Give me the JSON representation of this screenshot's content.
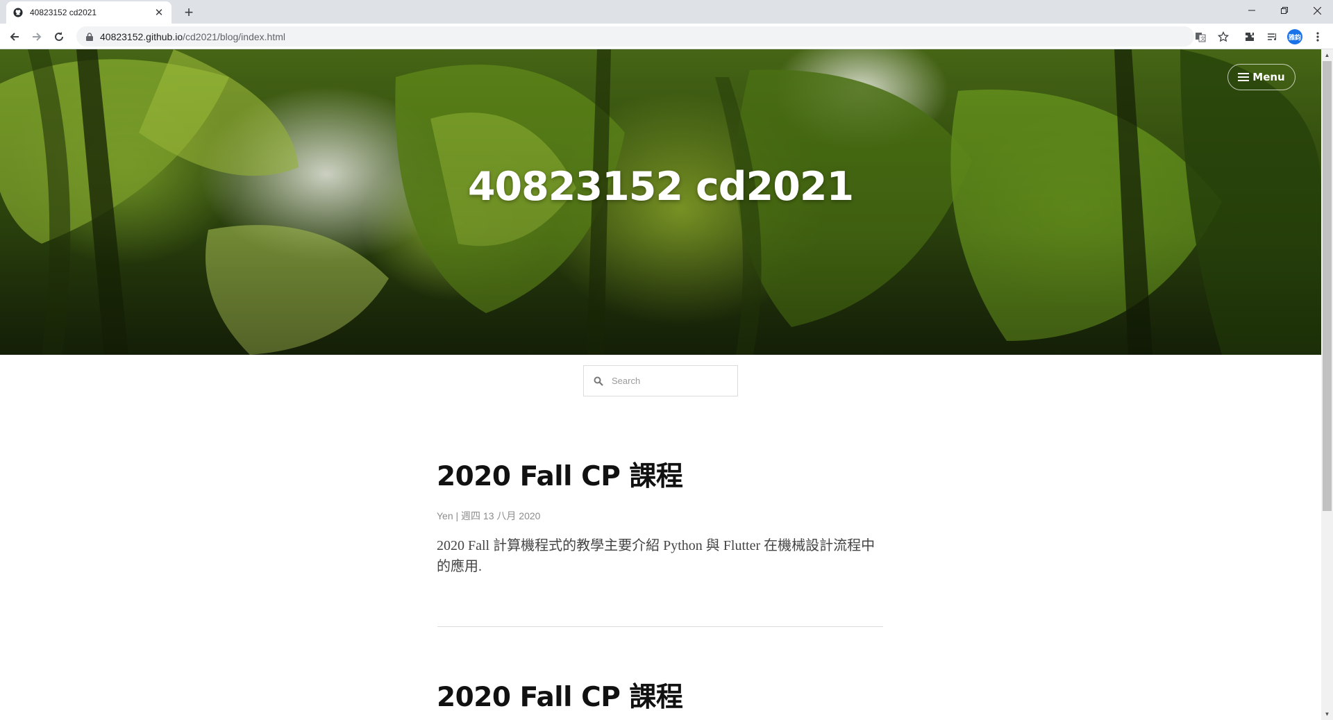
{
  "browser": {
    "tab_title": "40823152 cd2021",
    "url_host": "40823152.github.io",
    "url_path": "/cd2021/blog/index.html",
    "profile_initials": "雅鈞"
  },
  "hero": {
    "title": "40823152 cd2021",
    "menu_label": "Menu"
  },
  "search": {
    "placeholder": "Search"
  },
  "posts": [
    {
      "title": "2020 Fall CP 課程",
      "meta": "Yen | 週四 13 八月 2020",
      "summary": "2020 Fall 計算機程式的教學主要介紹 Python 與 Flutter 在機械設計流程中的應用."
    },
    {
      "title": "2020 Fall CP 課程"
    }
  ]
}
